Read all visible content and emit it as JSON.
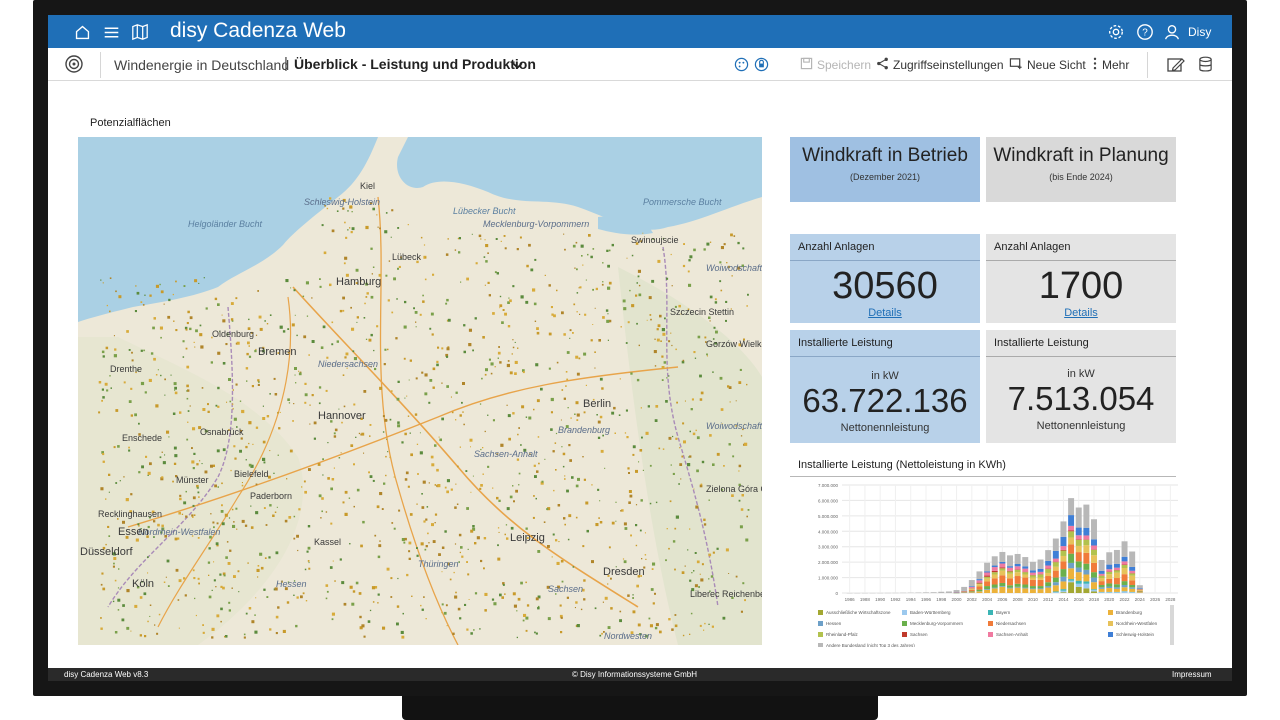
{
  "app": {
    "title": "disy Cadenza Web",
    "user": "Disy",
    "accent": "#1f6fb7"
  },
  "topbar": {
    "left_icons": [
      "home-icon",
      "menu-icon",
      "map-icon"
    ],
    "right_icons": [
      "gear-icon",
      "help-icon",
      "user-icon"
    ]
  },
  "breadcrumb": {
    "repository": "Windenergie in Deutschland",
    "separator": "|",
    "view": "Überblick - Leistung und Produktion"
  },
  "toolbar": {
    "save": "Speichern",
    "access": "Zugriffseinstellungen",
    "new_view": "Neue Sicht",
    "more": "Mehr"
  },
  "map": {
    "label": "Potenzialflächen",
    "places": [
      "Kiel",
      "Schleswig-Holstein",
      "Lübecker Bucht",
      "Pommersche Bucht",
      "Swinoujscie",
      "Helgoländer Bucht",
      "Lübeck",
      "Mecklenburg-Vorpommern",
      "Hamburg",
      "Woiwodschaft Westpommern",
      "Szczecin Stettin",
      "Oldenburg",
      "Bremen",
      "Niedersachsen",
      "Gorzów Wielkopolski Landsberg an der Warthe",
      "Drenthe",
      "Berlin",
      "Brandenburg",
      "Hannover",
      "Enschede",
      "Osnabrück",
      "Sachsen-Anhalt",
      "Woiwodschaft Lebus",
      "Bielefeld",
      "Münster",
      "Paderborn",
      "Zielona Góra Grünberg in Schlesien",
      "Recklinghausen",
      "Nordrhein-Westfalen",
      "Kassel",
      "Essen",
      "Düsseldorf",
      "Leipzig",
      "Hessen",
      "Thüringen",
      "Sachsen",
      "Köln",
      "Dresden",
      "Liberec Reichenberg",
      "Nordwesten"
    ]
  },
  "tiles": {
    "betrieb": {
      "title": "Windkraft in Betrieb",
      "subtitle": "(Dezember 2021)",
      "anlagen_label": "Anzahl Anlagen",
      "anlagen_value": "30560",
      "details": "Details",
      "leistung_label": "Installierte Leistung",
      "unit": "in kW",
      "leistung_value": "63.722.136",
      "note": "Nettonennleistung"
    },
    "planung": {
      "title": "Windkraft in Planung",
      "subtitle": "(bis Ende 2024)",
      "anlagen_label": "Anzahl Anlagen",
      "anlagen_value": "1700",
      "details": "Details",
      "leistung_label": "Installierte Leistung",
      "unit": "in kW",
      "leistung_value": "7.513.054",
      "note": "Nettonennleistung"
    },
    "colors": {
      "blue": "#b8d1e9",
      "blue_head": "#9fc0e2",
      "gray": "#e4e4e4",
      "gray_head": "#d9d9d9"
    }
  },
  "chart_data": {
    "type": "bar",
    "stacked": true,
    "title": "Installierte Leistung (Nettoleistung in KWh)",
    "ylim": [
      0,
      7000000
    ],
    "y_ticks": [
      "0",
      "1.000.000",
      "2.000.000",
      "3.000.000",
      "4.000.000",
      "5.000.000",
      "6.000.000",
      "7.000.000"
    ],
    "x_ticks": [
      "1986",
      "1988",
      "1990",
      "1992",
      "1994",
      "1996",
      "1998",
      "2000",
      "2002",
      "2004",
      "2006",
      "2008",
      "2010",
      "2012",
      "2014",
      "2016",
      "2018",
      "2020",
      "2022",
      "2024",
      "2026",
      "2028"
    ],
    "categories": [
      "1986",
      "1987",
      "1988",
      "1989",
      "1990",
      "1991",
      "1992",
      "1993",
      "1994",
      "1995",
      "1996",
      "1997",
      "1998",
      "1999",
      "2000",
      "2001",
      "2002",
      "2003",
      "2004",
      "2005",
      "2006",
      "2007",
      "2008",
      "2009",
      "2010",
      "2011",
      "2012",
      "2013",
      "2014",
      "2015",
      "2016",
      "2017",
      "2018",
      "2019",
      "2020",
      "2021",
      "2022",
      "2023",
      "2024"
    ],
    "series": [
      {
        "name": "Ausschließliche Wirtschaftszone",
        "color": "#a3a832",
        "values": [
          0,
          0,
          0,
          0,
          0,
          0,
          0,
          0,
          0,
          0,
          0,
          0,
          0,
          0,
          0,
          0,
          0,
          0,
          0,
          0,
          0,
          0,
          0,
          0,
          0,
          0,
          0,
          0,
          50000,
          700000,
          400000,
          300000,
          100000,
          0,
          0,
          0,
          0,
          0,
          0
        ]
      },
      {
        "name": "Baden-Württemberg",
        "color": "#9cc9ee",
        "values": [
          0,
          0,
          0,
          0,
          0,
          0,
          0,
          0,
          0,
          0,
          0,
          0,
          0,
          0,
          0,
          0,
          0,
          0,
          0,
          0,
          0,
          0,
          0,
          0,
          0,
          0,
          0,
          50000,
          100000,
          100000,
          200000,
          300000,
          100000,
          50000,
          50000,
          50000,
          100000,
          50000,
          0
        ]
      },
      {
        "name": "Bayern",
        "color": "#3bb5b5",
        "values": [
          0,
          0,
          0,
          0,
          0,
          0,
          0,
          0,
          0,
          0,
          0,
          0,
          0,
          0,
          0,
          0,
          0,
          0,
          0,
          0,
          0,
          0,
          0,
          0,
          0,
          0,
          0,
          50000,
          100000,
          100000,
          200000,
          150000,
          50000,
          20000,
          20000,
          20000,
          20000,
          20000,
          0
        ]
      },
      {
        "name": "Brandenburg",
        "color": "#ecb23a",
        "values": [
          0,
          0,
          0,
          0,
          0,
          0,
          0,
          0,
          0,
          0,
          0,
          0,
          0,
          0,
          5000,
          20000,
          50000,
          100000,
          200000,
          300000,
          400000,
          300000,
          350000,
          300000,
          250000,
          250000,
          350000,
          400000,
          500000,
          700000,
          550000,
          450000,
          450000,
          200000,
          250000,
          200000,
          250000,
          200000,
          50000
        ]
      },
      {
        "name": "Hessen",
        "color": "#6da0c8",
        "values": [
          0,
          0,
          0,
          0,
          0,
          0,
          0,
          0,
          0,
          0,
          0,
          0,
          0,
          0,
          2000,
          5000,
          10000,
          20000,
          50000,
          50000,
          50000,
          50000,
          50000,
          50000,
          50000,
          50000,
          100000,
          200000,
          300000,
          350000,
          300000,
          300000,
          300000,
          100000,
          100000,
          100000,
          150000,
          100000,
          20000
        ]
      },
      {
        "name": "Mecklenburg-Vorpommern",
        "color": "#6ab04c",
        "values": [
          0,
          0,
          0,
          0,
          0,
          0,
          0,
          0,
          0,
          0,
          0,
          0,
          0,
          0,
          5000,
          20000,
          50000,
          100000,
          200000,
          200000,
          200000,
          150000,
          200000,
          200000,
          150000,
          150000,
          250000,
          300000,
          500000,
          600000,
          400000,
          400000,
          350000,
          150000,
          200000,
          200000,
          250000,
          150000,
          30000
        ]
      },
      {
        "name": "Niedersachsen",
        "color": "#f07b3a",
        "values": [
          0,
          0,
          0,
          0,
          0,
          0,
          0,
          0,
          0,
          0,
          0,
          0,
          0,
          0,
          10000,
          30000,
          100000,
          200000,
          300000,
          400000,
          500000,
          450000,
          500000,
          450000,
          400000,
          400000,
          400000,
          450000,
          500000,
          600000,
          600000,
          700000,
          600000,
          250000,
          300000,
          400000,
          450000,
          300000,
          50000
        ]
      },
      {
        "name": "Nordrhein-Westfalen",
        "color": "#e7c25a",
        "values": [
          0,
          0,
          0,
          0,
          0,
          0,
          0,
          0,
          0,
          0,
          0,
          0,
          0,
          0,
          5000,
          20000,
          60000,
          150000,
          200000,
          250000,
          300000,
          300000,
          250000,
          200000,
          150000,
          150000,
          200000,
          250000,
          350000,
          450000,
          400000,
          500000,
          500000,
          200000,
          300000,
          350000,
          400000,
          300000,
          50000
        ]
      },
      {
        "name": "Rheinland-Pfalz",
        "color": "#b2c24e",
        "values": [
          0,
          0,
          0,
          0,
          0,
          0,
          0,
          0,
          0,
          0,
          0,
          0,
          0,
          0,
          2000,
          5000,
          20000,
          50000,
          100000,
          150000,
          150000,
          150000,
          150000,
          150000,
          150000,
          200000,
          250000,
          300000,
          350000,
          400000,
          400000,
          350000,
          350000,
          150000,
          150000,
          150000,
          200000,
          150000,
          30000
        ]
      },
      {
        "name": "Sachsen",
        "color": "#c0392b",
        "values": [
          0,
          0,
          0,
          0,
          0,
          0,
          0,
          0,
          0,
          0,
          0,
          0,
          0,
          0,
          2000,
          5000,
          20000,
          50000,
          80000,
          80000,
          60000,
          40000,
          30000,
          30000,
          20000,
          20000,
          30000,
          30000,
          40000,
          50000,
          40000,
          30000,
          30000,
          20000,
          20000,
          20000,
          30000,
          20000,
          5000
        ]
      },
      {
        "name": "Sachsen-Anhalt",
        "color": "#f07aa0",
        "values": [
          0,
          0,
          0,
          0,
          0,
          0,
          0,
          0,
          0,
          0,
          0,
          0,
          0,
          0,
          5000,
          20000,
          80000,
          150000,
          200000,
          250000,
          250000,
          200000,
          200000,
          200000,
          150000,
          150000,
          200000,
          200000,
          250000,
          300000,
          250000,
          250000,
          250000,
          100000,
          150000,
          150000,
          200000,
          150000,
          20000
        ]
      },
      {
        "name": "Schleswig-Holstein",
        "color": "#3f7fd6",
        "values": [
          0,
          0,
          0,
          0,
          0,
          0,
          0,
          0,
          0,
          0,
          0,
          0,
          0,
          0,
          5000,
          20000,
          50000,
          80000,
          80000,
          100000,
          100000,
          100000,
          150000,
          150000,
          150000,
          200000,
          300000,
          500000,
          600000,
          700000,
          500000,
          500000,
          400000,
          200000,
          300000,
          250000,
          300000,
          250000,
          50000
        ]
      },
      {
        "name": "Andere Bundesland (nicht Top 3 des Jahres)",
        "color": "#b8b8b8",
        "values": [
          2000,
          2000,
          3000,
          4000,
          5000,
          8000,
          10000,
          15000,
          20000,
          30000,
          40000,
          50000,
          80000,
          100000,
          150000,
          250000,
          400000,
          500000,
          550000,
          600000,
          650000,
          700000,
          650000,
          600000,
          550000,
          600000,
          700000,
          800000,
          1000000,
          1100000,
          1300000,
          1500000,
          1300000,
          700000,
          800000,
          900000,
          1000000,
          1000000,
          200000
        ]
      }
    ]
  },
  "footer": {
    "version": "disy Cadenza Web v8.3",
    "copyright": "© Disy Informationssysteme GmbH",
    "imprint": "Impressum"
  }
}
